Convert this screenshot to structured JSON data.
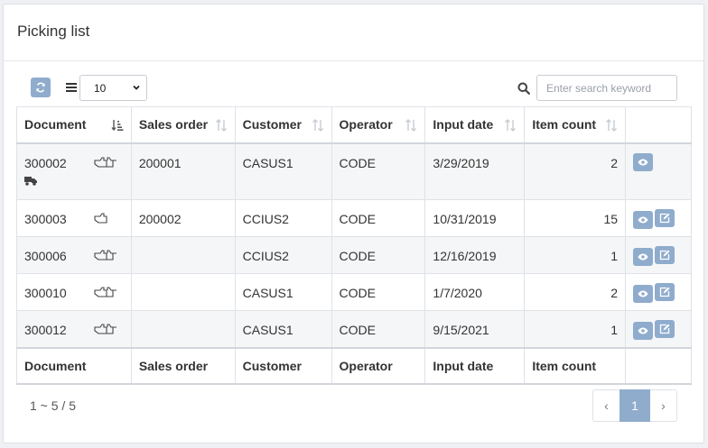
{
  "panel": {
    "title": "Picking list"
  },
  "toolbar": {
    "page_size": "10",
    "search_placeholder": "Enter search keyword"
  },
  "table": {
    "columns": [
      "Document",
      "Sales order",
      "Customer",
      "Operator",
      "Input date",
      "Item count"
    ],
    "rows": [
      {
        "document": "300002",
        "sales_order": "200001",
        "customer": "CASUS1",
        "operator": "CODE",
        "input_date": "3/29/2019",
        "item_count": "2",
        "status_icon": "double-hand-icon",
        "extra_icon": "truck-icon",
        "actions": [
          "view"
        ]
      },
      {
        "document": "300003",
        "sales_order": "200002",
        "customer": "CCIUS2",
        "operator": "CODE",
        "input_date": "10/31/2019",
        "item_count": "15",
        "status_icon": "hand-pointing-icon",
        "actions": [
          "view",
          "edit"
        ]
      },
      {
        "document": "300006",
        "sales_order": "",
        "customer": "CCIUS2",
        "operator": "CODE",
        "input_date": "12/16/2019",
        "item_count": "1",
        "status_icon": "double-hand-icon",
        "actions": [
          "view",
          "edit"
        ]
      },
      {
        "document": "300010",
        "sales_order": "",
        "customer": "CASUS1",
        "operator": "CODE",
        "input_date": "1/7/2020",
        "item_count": "2",
        "status_icon": "double-hand-icon",
        "actions": [
          "view",
          "edit"
        ]
      },
      {
        "document": "300012",
        "sales_order": "",
        "customer": "CASUS1",
        "operator": "CODE",
        "input_date": "9/15/2021",
        "item_count": "1",
        "status_icon": "double-hand-icon",
        "actions": [
          "view",
          "edit"
        ]
      }
    ]
  },
  "footer": {
    "summary": "1 ~ 5 / 5"
  },
  "pager": {
    "prev": "‹",
    "current": "1",
    "next": "›"
  },
  "colors": {
    "accent": "#8faccd"
  }
}
